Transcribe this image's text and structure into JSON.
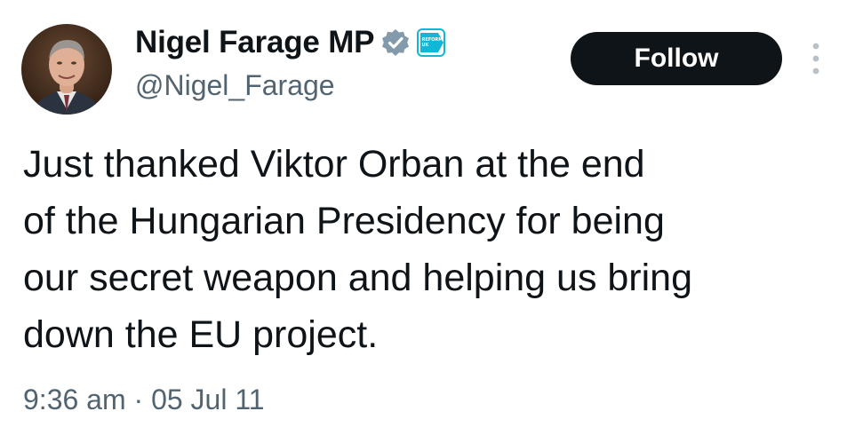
{
  "author": {
    "display_name": "Nigel Farage MP",
    "handle": "@Nigel_Farage",
    "verified_badge_icon": "verified-badge-icon",
    "affiliate_badge_icon": "reform-uk-affiliate-icon",
    "affiliate_badge_text": "REFORM UK"
  },
  "actions": {
    "follow_label": "Follow",
    "more_icon": "more-options-icon"
  },
  "tweet": {
    "lines": [
      "Just thanked Viktor Orban at the end",
      "of the Hungarian Presidency for being",
      "our secret weapon and helping us bring",
      "down the EU project."
    ],
    "time": "9:36 am",
    "separator": "·",
    "date": "05 Jul 11"
  },
  "colors": {
    "text_primary": "#0f1419",
    "text_secondary": "#536471",
    "follow_bg": "#0f1419",
    "verified_gray": "#829aab",
    "affiliate_teal": "#12b6d6"
  }
}
